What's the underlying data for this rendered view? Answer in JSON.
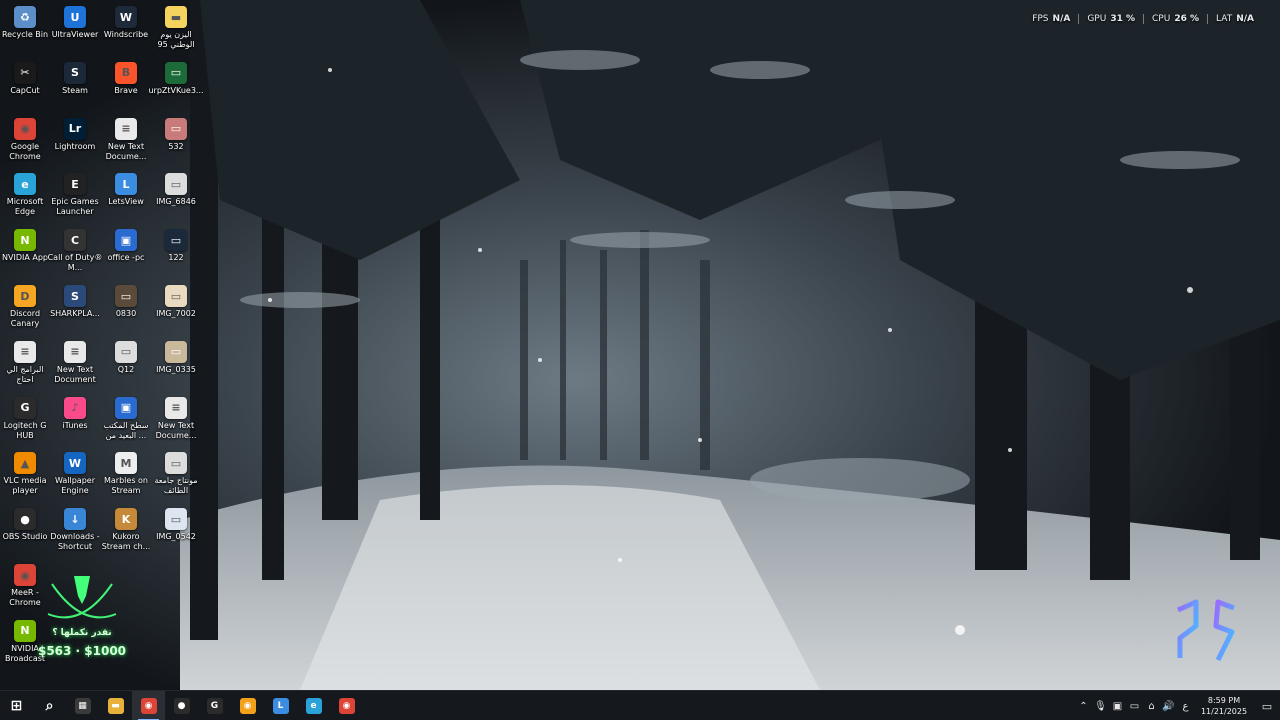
{
  "overlay": {
    "stats": [
      {
        "label": "FPS",
        "value": "N/A"
      },
      {
        "label": "GPU",
        "value": "31 %"
      },
      {
        "label": "CPU",
        "value": "26 %"
      },
      {
        "label": "LAT",
        "value": "N/A"
      }
    ]
  },
  "desktop": {
    "columns": [
      [
        {
          "label": "Recycle Bin",
          "icon": "recycle-bin-icon",
          "color": "#5c8fc9",
          "glyph": "♻"
        },
        {
          "label": "CapCut",
          "icon": "capcut-icon",
          "color": "#1a1a1a",
          "glyph": "✂"
        },
        {
          "label": "Google Chrome",
          "icon": "chrome-icon",
          "color": "#db4437",
          "glyph": "◉"
        },
        {
          "label": "Microsoft Edge",
          "icon": "edge-icon",
          "color": "#2aa3d8",
          "glyph": "e"
        },
        {
          "label": "NVIDIA App",
          "icon": "nvidia-icon",
          "color": "#76b900",
          "glyph": "N"
        },
        {
          "label": "Discord Canary",
          "icon": "discord-canary-icon",
          "color": "#f5a623",
          "glyph": "D"
        },
        {
          "label": "البرامج الي احتاج",
          "icon": "text-file-icon",
          "color": "#e9e9e9",
          "glyph": "≡"
        },
        {
          "label": "Logitech G HUB",
          "icon": "logitech-icon",
          "color": "#2b2b2b",
          "glyph": "G"
        },
        {
          "label": "VLC media player",
          "icon": "vlc-icon",
          "color": "#f08a00",
          "glyph": "▲"
        },
        {
          "label": "OBS Studio",
          "icon": "obs-icon",
          "color": "#2b2b2b",
          "glyph": "●"
        },
        {
          "label": "MeeR - Chrome",
          "icon": "chrome-icon",
          "color": "#db4437",
          "glyph": "◉"
        },
        {
          "label": "NVIDIA Broadcast",
          "icon": "nvidia-broadcast-icon",
          "color": "#76b900",
          "glyph": "N"
        }
      ],
      [
        {
          "label": "UltraViewer",
          "icon": "ultraviewer-icon",
          "color": "#1e73d9",
          "glyph": "U"
        },
        {
          "label": "Steam",
          "icon": "steam-icon",
          "color": "#1b2838",
          "glyph": "S"
        },
        {
          "label": "Lightroom",
          "icon": "lightroom-icon",
          "color": "#001e36",
          "glyph": "Lr"
        },
        {
          "label": "Epic Games Launcher",
          "icon": "epic-games-icon",
          "color": "#222",
          "glyph": "E"
        },
        {
          "label": "Call of Duty® M...",
          "icon": "call-of-duty-icon",
          "color": "#333",
          "glyph": "C"
        },
        {
          "label": "SHARKPLA...",
          "icon": "sharkplay-icon",
          "color": "#2b4a7a",
          "glyph": "S"
        },
        {
          "label": "New Text Document",
          "icon": "text-file-icon",
          "color": "#e9e9e9",
          "glyph": "≡"
        },
        {
          "label": "iTunes",
          "icon": "itunes-icon",
          "color": "#fa4a8a",
          "glyph": "♪"
        },
        {
          "label": "Wallpaper Engine",
          "icon": "wallpaper-engine-icon",
          "color": "#1566c0",
          "glyph": "W"
        },
        {
          "label": "Downloads - Shortcut",
          "icon": "downloads-icon",
          "color": "#3a86d6",
          "glyph": "↓"
        }
      ],
      [
        {
          "label": "Windscribe",
          "icon": "windscribe-icon",
          "color": "#1e2a3a",
          "glyph": "W"
        },
        {
          "label": "Brave",
          "icon": "brave-icon",
          "color": "#fb542b",
          "glyph": "B"
        },
        {
          "label": "New Text Docume...",
          "icon": "text-file-icon",
          "color": "#e9e9e9",
          "glyph": "≡"
        },
        {
          "label": "LetsView",
          "icon": "letsview-icon",
          "color": "#3a8de0",
          "glyph": "L"
        },
        {
          "label": "office -pc",
          "icon": "remote-desktop-icon",
          "color": "#2a6bd1",
          "glyph": "▣"
        },
        {
          "label": "0830",
          "icon": "image-file-icon",
          "color": "#5a4a3a",
          "glyph": "▭"
        },
        {
          "label": "Q12",
          "icon": "image-file-icon",
          "color": "#dddddd",
          "glyph": "▭"
        },
        {
          "label": "سطح المكتب البعيد من ...",
          "icon": "remote-desktop-icon",
          "color": "#2a6bd1",
          "glyph": "▣"
        },
        {
          "label": "Marbles on Stream",
          "icon": "marbles-icon",
          "color": "#eeeeee",
          "glyph": "M"
        },
        {
          "label": "Kukoro Stream ch...",
          "icon": "kukoro-icon",
          "color": "#c48a3a",
          "glyph": "K"
        }
      ],
      [
        {
          "label": "اليزن يوم الوطني 95",
          "icon": "folder-icon",
          "color": "#f4d35e",
          "glyph": "▬"
        },
        {
          "label": "urpZtVKue3...",
          "icon": "image-file-icon",
          "color": "#1e6b3a",
          "glyph": "▭"
        },
        {
          "label": "532",
          "icon": "image-file-icon",
          "color": "#c97a7a",
          "glyph": "▭"
        },
        {
          "label": "IMG_6846",
          "icon": "image-file-icon",
          "color": "#dddddd",
          "glyph": "▭"
        },
        {
          "label": "122",
          "icon": "image-file-icon",
          "color": "#1a2a3a",
          "glyph": "▭"
        },
        {
          "label": "IMG_7002",
          "icon": "image-file-icon",
          "color": "#eadbc0",
          "glyph": "▭"
        },
        {
          "label": "IMG_0335",
          "icon": "image-file-icon",
          "color": "#c9b89a",
          "glyph": "▭"
        },
        {
          "label": "New Text Docume...",
          "icon": "text-file-icon",
          "color": "#e9e9e9",
          "glyph": "≡"
        },
        {
          "label": "مونتاج جامعة الطائف",
          "icon": "image-file-icon",
          "color": "#dddddd",
          "glyph": "▭"
        },
        {
          "label": "IMG_0542",
          "icon": "image-file-icon",
          "color": "#dde6f0",
          "glyph": "▭"
        }
      ]
    ]
  },
  "badge": {
    "line1": "نقدر نكملها ؟",
    "line2": "$563 · $1000"
  },
  "taskbar": {
    "items": [
      {
        "name": "start-button",
        "icon": "windows-icon",
        "glyph": "⊞",
        "color": "transparent"
      },
      {
        "name": "search-button",
        "icon": "search-icon",
        "glyph": "⌕",
        "color": "transparent"
      },
      {
        "name": "taskbar-store",
        "icon": "store-icon",
        "glyph": "▦",
        "color": "#3a3a3a"
      },
      {
        "name": "taskbar-explorer",
        "icon": "folder-icon",
        "glyph": "▬",
        "color": "#e8b23a"
      },
      {
        "name": "taskbar-chrome",
        "icon": "chrome-icon",
        "glyph": "◉",
        "color": "#db4437",
        "active": true
      },
      {
        "name": "taskbar-obs",
        "icon": "obs-icon",
        "glyph": "●",
        "color": "#2b2b2b"
      },
      {
        "name": "taskbar-ghub",
        "icon": "logitech-icon",
        "glyph": "G",
        "color": "#2b2b2b"
      },
      {
        "name": "taskbar-chrome-canary",
        "icon": "chrome-canary-icon",
        "glyph": "◉",
        "color": "#f3a01a"
      },
      {
        "name": "taskbar-letsview",
        "icon": "letsview-icon",
        "glyph": "L",
        "color": "#3a8de0"
      },
      {
        "name": "taskbar-edge",
        "icon": "edge-icon",
        "glyph": "e",
        "color": "#2aa3d8"
      },
      {
        "name": "taskbar-chrome-2",
        "icon": "chrome-icon",
        "glyph": "◉",
        "color": "#db4437"
      }
    ],
    "tray": {
      "icons": [
        "chevron-up-icon",
        "microphone-icon",
        "nvidia-icon",
        "monitor-icon",
        "network-icon",
        "volume-icon"
      ],
      "language": "ع",
      "time": "8:59 PM",
      "date": "11/21/2025"
    }
  }
}
